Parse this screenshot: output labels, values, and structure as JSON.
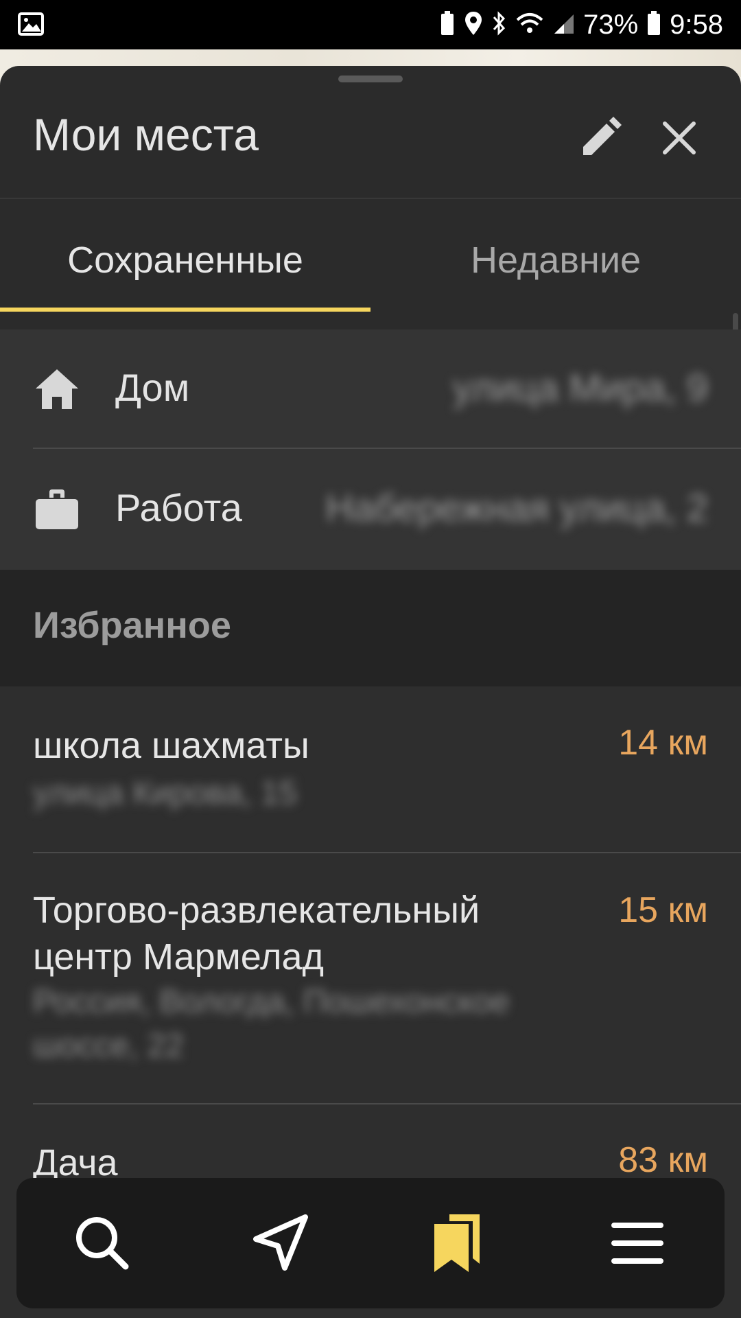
{
  "status_bar": {
    "battery_percent": "73%",
    "time": "9:58"
  },
  "header": {
    "title": "Мои места"
  },
  "tabs": [
    {
      "label": "Сохраненные",
      "active": true
    },
    {
      "label": "Недавние",
      "active": false
    }
  ],
  "addresses": [
    {
      "label": "Дом",
      "icon": "home-icon",
      "value": "улица Мира, 9"
    },
    {
      "label": "Работа",
      "icon": "briefcase-icon",
      "value": "Набережная улица, 2"
    }
  ],
  "favorites": {
    "title": "Избранное",
    "items": [
      {
        "name": "школа шахматы",
        "distance": "14 км",
        "address": "улица Кирова, 15"
      },
      {
        "name": "Торгово-развлекательный центр Мармелад",
        "distance": "15 км",
        "address": "Россия, Вологда, Пошехонское шоссе, 22"
      },
      {
        "name": "Дача",
        "distance": "83 км",
        "address": ""
      }
    ]
  },
  "bottom_nav": [
    {
      "icon": "search-icon"
    },
    {
      "icon": "navigation-arrow-icon"
    },
    {
      "icon": "bookmarks-icon",
      "active": true
    },
    {
      "icon": "menu-icon"
    }
  ],
  "colors": {
    "accent": "#f6d65e",
    "distance": "#e8a65e",
    "sheet_bg": "#2b2b2b"
  }
}
